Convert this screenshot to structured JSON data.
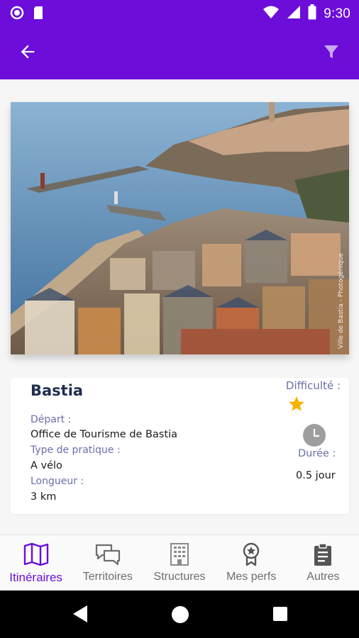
{
  "status_bar": {
    "time": "9:30",
    "icons": [
      "record-icon",
      "sim-card-icon",
      "wifi-icon",
      "signal-icon",
      "battery-icon"
    ]
  },
  "app_bar": {
    "icons": [
      "arrow-back-icon",
      "filter-icon"
    ],
    "color": "#6c0dd9"
  },
  "photo": {
    "credit": "Ville de Bastia - Photogénique"
  },
  "itinerary": {
    "name": "Bastia",
    "depart_label": "Départ :",
    "depart_value": "Office de Tourisme de Bastia",
    "type_label": "Type de pratique :",
    "type_value": "A vélo",
    "longueur_label": "Longueur :",
    "longueur_value": "3 km",
    "difficulte_label": "Difficulté :",
    "difficulte_stars": 1,
    "duree_label": "Durée :",
    "duree_value": "0.5 jour"
  },
  "bottom_nav": {
    "items": [
      {
        "label": "Itinéraires",
        "icon": "map-icon",
        "active": true
      },
      {
        "label": "Territoires",
        "icon": "chat-bubbles-icon",
        "active": false
      },
      {
        "label": "Structures",
        "icon": "building-icon",
        "active": false
      },
      {
        "label": "Mes perfs",
        "icon": "medal-icon",
        "active": false
      },
      {
        "label": "Autres",
        "icon": "clipboard-icon",
        "active": false
      }
    ]
  },
  "colors": {
    "primary": "#6c0dd9",
    "title": "#1e2d4f",
    "label": "#6b6fa8",
    "star": "#f5b400",
    "inactive": "#6d6d6d"
  }
}
